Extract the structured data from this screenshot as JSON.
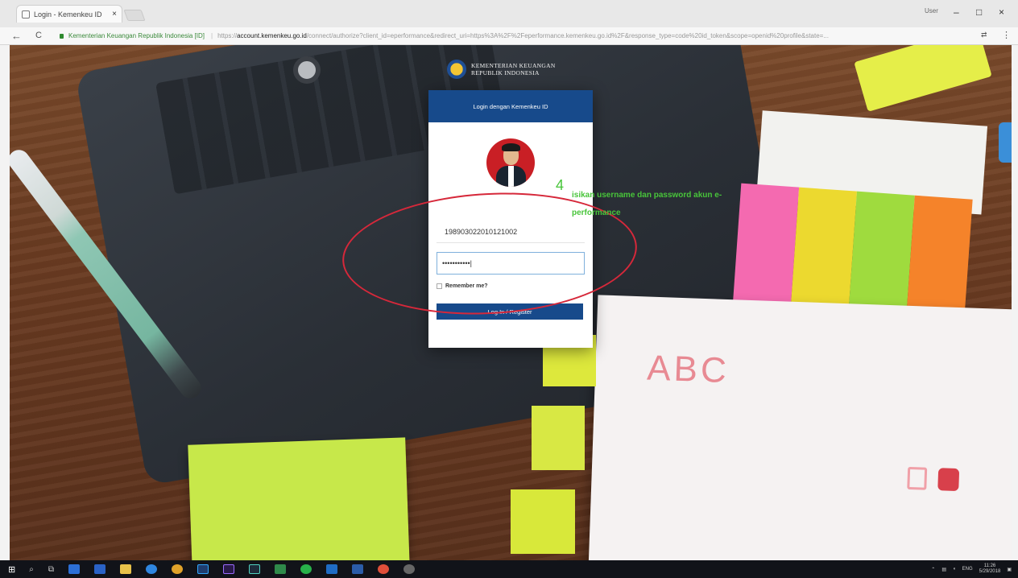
{
  "browser": {
    "tab_title": "Login - Kemenkeu ID",
    "tab_close": "×",
    "window_user": "User",
    "minimize": "–",
    "maximize": "□",
    "close": "×",
    "back": "←",
    "reload": "C",
    "site_name": "Kementerian Keuangan Republik Indonesia [ID]",
    "url_scheme": "https://",
    "url_host": "account.kemenkeu.go.id",
    "url_path": "/connect/authorize?client_id=eperformance&redirect_uri=https%3A%2F%2Feperformance.kemenkeu.go.id%2F&response_type=code%20id_token&scope=openid%20profile&state=..."
  },
  "page": {
    "brand_line1": "KEMENTERIAN KEUANGAN",
    "brand_line2": "REPUBLIK INDONESIA",
    "card_title": "Login dengan Kemenkeu ID",
    "username_value": "198903022010121002",
    "password_value": "•••••••••••|",
    "remember_label": "Remember me?",
    "login_button": "Log In / Register",
    "notebook_text": "ABC"
  },
  "annotation": {
    "step": "4",
    "text": "isikan username dan password akun e-performance",
    "color": "#48c53a",
    "ellipse_color": "#d6283a"
  },
  "taskbar": {
    "start_glyph": "⊞",
    "search_glyph": "⌕",
    "taskview_glyph": "⧉",
    "apps": [
      "file-explorer",
      "store",
      "edge",
      "chrome",
      "photoshop",
      "premiere",
      "audition",
      "excel-like",
      "whatsapp",
      "outlook",
      "word",
      "chrome-2",
      "other"
    ],
    "tray_lang": "ENG",
    "tray_time": "11:26",
    "tray_date": "5/29/2018"
  },
  "colors": {
    "header_blue": "#174a8b",
    "taskbar": "#111319"
  }
}
